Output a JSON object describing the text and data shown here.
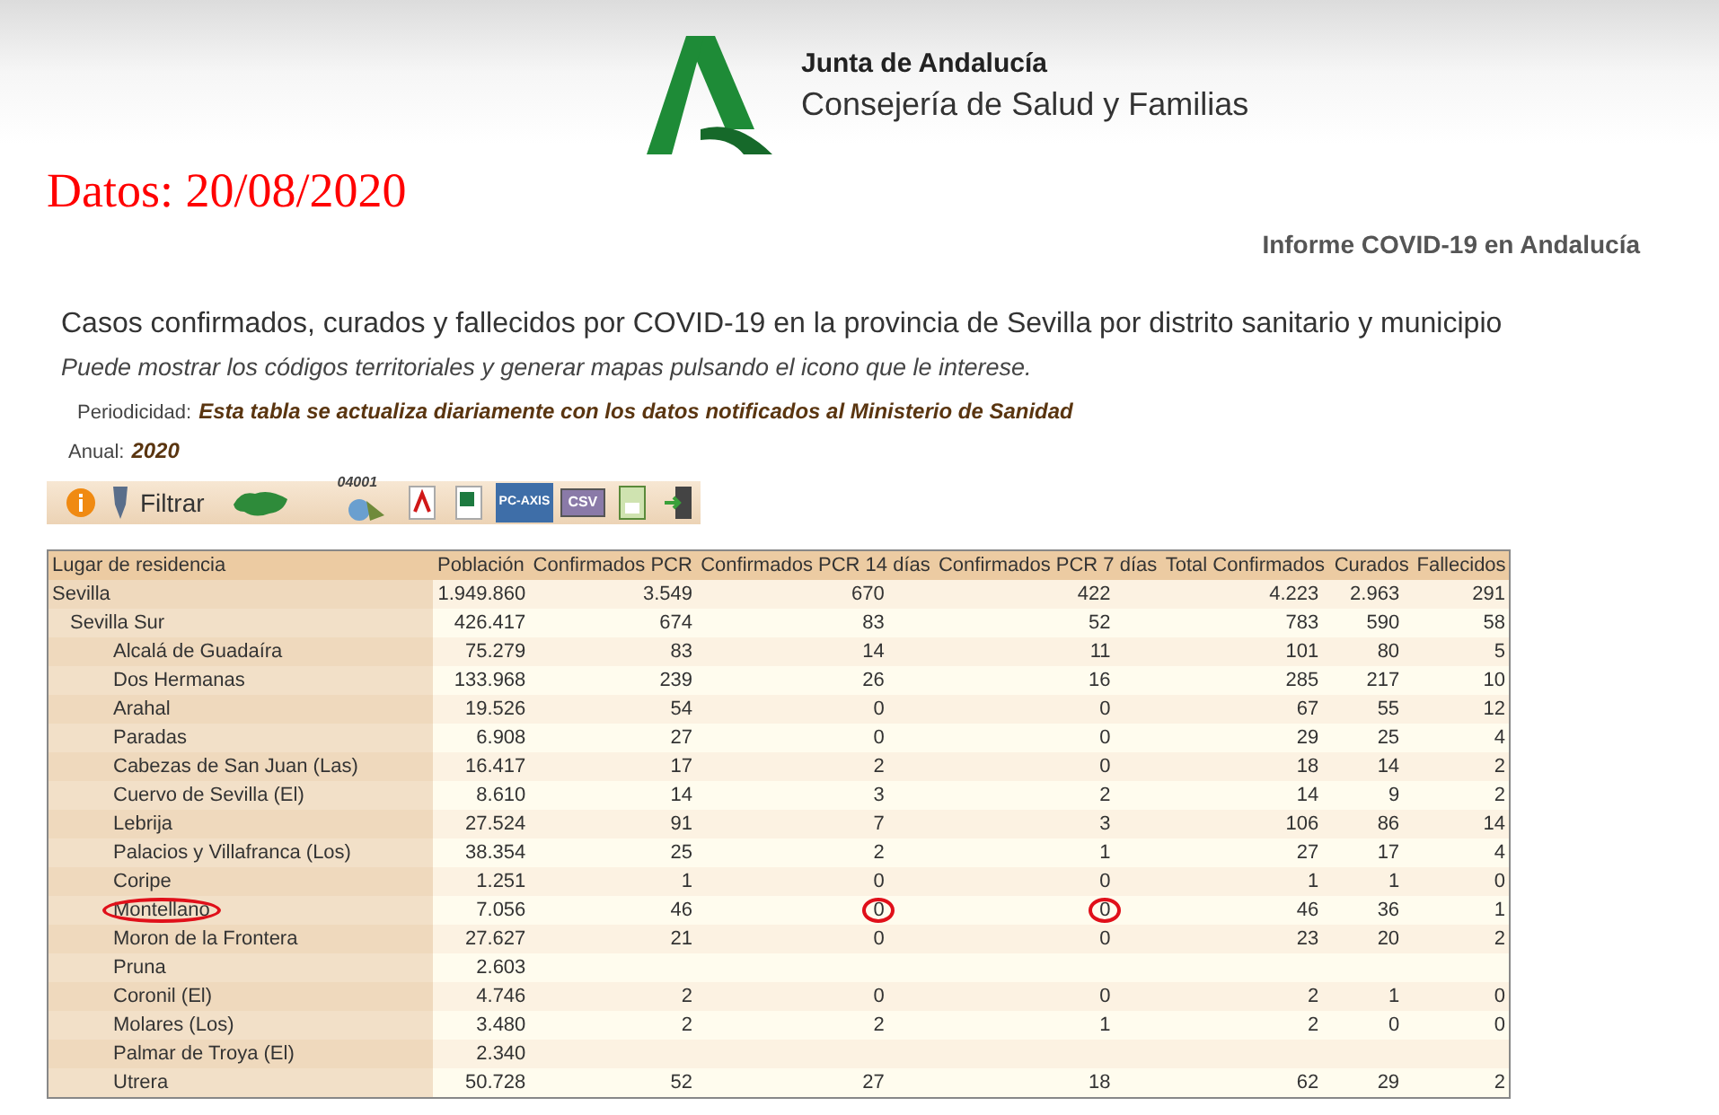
{
  "header": {
    "org": "Junta de Andalucía",
    "department": "Consejería de Salud y Familias"
  },
  "date_label": "Datos: 20/08/2020",
  "report_title": "Informe COVID-19 en Andalucía",
  "title": "Casos confirmados, curados y fallecidos por COVID-19 en la provincia de Sevilla por distrito sanitario y municipio",
  "subtitle": "Puede mostrar los códigos territoriales y generar mapas pulsando el icono que le interese.",
  "periodicity": {
    "label": "Periodicidad:",
    "value": "Esta tabla se actualiza diariamente con los datos notificados al Ministerio de Sanidad"
  },
  "annual": {
    "label": "Anual:",
    "value": "2020"
  },
  "toolbar": {
    "filter_label": "Filtrar",
    "codes_label": "04001",
    "pcaxis_label": "PC-AXIS",
    "csv_label": "CSV"
  },
  "table": {
    "columns": [
      "Lugar de residencia",
      "Población",
      "Confirmados PCR",
      "Confirmados PCR 14 días",
      "Confirmados PCR 7 días",
      "Total Confirmados",
      "Curados",
      "Fallecidos"
    ],
    "rows": [
      {
        "name": "Sevilla",
        "values": [
          "1.949.860",
          "3.549",
          "670",
          "422",
          "4.223",
          "2.963",
          "291"
        ],
        "circled": [
          false,
          false,
          false,
          false,
          false,
          false,
          false,
          false
        ],
        "children": [
          {
            "name": "Sevilla Sur",
            "values": [
              "426.417",
              "674",
              "83",
              "52",
              "783",
              "590",
              "58"
            ],
            "circled": [
              false,
              false,
              false,
              false,
              false,
              false,
              false,
              false
            ],
            "children": [
              {
                "name": "Alcalá de Guadaíra",
                "values": [
                  "75.279",
                  "83",
                  "14",
                  "11",
                  "101",
                  "80",
                  "5"
                ],
                "circled": [
                  false,
                  false,
                  false,
                  false,
                  false,
                  false,
                  false,
                  false
                ]
              },
              {
                "name": "Dos Hermanas",
                "values": [
                  "133.968",
                  "239",
                  "26",
                  "16",
                  "285",
                  "217",
                  "10"
                ],
                "circled": [
                  false,
                  false,
                  false,
                  false,
                  false,
                  false,
                  false,
                  false
                ]
              },
              {
                "name": "Arahal",
                "values": [
                  "19.526",
                  "54",
                  "0",
                  "0",
                  "67",
                  "55",
                  "12"
                ],
                "circled": [
                  false,
                  false,
                  false,
                  false,
                  false,
                  false,
                  false,
                  false
                ]
              },
              {
                "name": "Paradas",
                "values": [
                  "6.908",
                  "27",
                  "0",
                  "0",
                  "29",
                  "25",
                  "4"
                ],
                "circled": [
                  false,
                  false,
                  false,
                  false,
                  false,
                  false,
                  false,
                  false
                ]
              },
              {
                "name": "Cabezas de San Juan (Las)",
                "values": [
                  "16.417",
                  "17",
                  "2",
                  "0",
                  "18",
                  "14",
                  "2"
                ],
                "circled": [
                  false,
                  false,
                  false,
                  false,
                  false,
                  false,
                  false,
                  false
                ]
              },
              {
                "name": "Cuervo de Sevilla (El)",
                "values": [
                  "8.610",
                  "14",
                  "3",
                  "2",
                  "14",
                  "9",
                  "2"
                ],
                "circled": [
                  false,
                  false,
                  false,
                  false,
                  false,
                  false,
                  false,
                  false
                ]
              },
              {
                "name": "Lebrija",
                "values": [
                  "27.524",
                  "91",
                  "7",
                  "3",
                  "106",
                  "86",
                  "14"
                ],
                "circled": [
                  false,
                  false,
                  false,
                  false,
                  false,
                  false,
                  false,
                  false
                ]
              },
              {
                "name": "Palacios y Villafranca (Los)",
                "values": [
                  "38.354",
                  "25",
                  "2",
                  "1",
                  "27",
                  "17",
                  "4"
                ],
                "circled": [
                  false,
                  false,
                  false,
                  false,
                  false,
                  false,
                  false,
                  false
                ]
              },
              {
                "name": "Coripe",
                "values": [
                  "1.251",
                  "1",
                  "0",
                  "0",
                  "1",
                  "1",
                  "0"
                ],
                "circled": [
                  false,
                  false,
                  false,
                  false,
                  false,
                  false,
                  false,
                  false
                ]
              },
              {
                "name": "Montellano",
                "values": [
                  "7.056",
                  "46",
                  "0",
                  "0",
                  "46",
                  "36",
                  "1"
                ],
                "circled": [
                  true,
                  false,
                  false,
                  true,
                  true,
                  false,
                  false,
                  false
                ]
              },
              {
                "name": "Moron de la Frontera",
                "values": [
                  "27.627",
                  "21",
                  "0",
                  "0",
                  "23",
                  "20",
                  "2"
                ],
                "circled": [
                  false,
                  false,
                  false,
                  false,
                  false,
                  false,
                  false,
                  false
                ]
              },
              {
                "name": "Pruna",
                "values": [
                  "2.603"
                ],
                "circled": [
                  false,
                  false,
                  false,
                  false,
                  false,
                  false,
                  false,
                  false
                ]
              },
              {
                "name": "Coronil (El)",
                "values": [
                  "4.746",
                  "2",
                  "0",
                  "0",
                  "2",
                  "1",
                  "0"
                ],
                "circled": [
                  false,
                  false,
                  false,
                  false,
                  false,
                  false,
                  false,
                  false
                ]
              },
              {
                "name": "Molares (Los)",
                "values": [
                  "3.480",
                  "2",
                  "2",
                  "1",
                  "2",
                  "0",
                  "0"
                ],
                "circled": [
                  false,
                  false,
                  false,
                  false,
                  false,
                  false,
                  false,
                  false
                ]
              },
              {
                "name": "Palmar de Troya (El)",
                "values": [
                  "2.340"
                ],
                "circled": [
                  false,
                  false,
                  false,
                  false,
                  false,
                  false,
                  false,
                  false
                ]
              },
              {
                "name": "Utrera",
                "values": [
                  "50.728",
                  "52",
                  "27",
                  "18",
                  "62",
                  "29",
                  "2"
                ],
                "circled": [
                  false,
                  false,
                  false,
                  false,
                  false,
                  false,
                  false,
                  false
                ]
              }
            ]
          }
        ]
      }
    ]
  }
}
